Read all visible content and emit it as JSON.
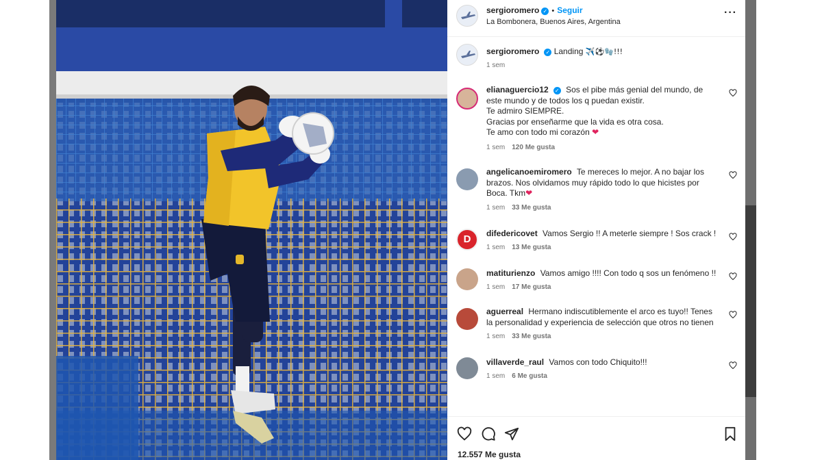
{
  "post": {
    "author": "sergioromero",
    "follow_label": "Seguir",
    "location": "La Bombonera, Buenos Aires, Argentina",
    "caption_text": "Landing",
    "caption_emoji": "✈️⚽🧤!!!",
    "caption_time": "1 sem",
    "likes_total": "12.557 Me gusta"
  },
  "colors": {
    "accent": "#0095f6",
    "secondary_text": "#737373",
    "heart_red": "#e0245e",
    "photo_sky": "#1f3f95",
    "net_yellow": "#e8b43a"
  },
  "comments": [
    {
      "username": "elianaguercio12",
      "verified": true,
      "text": "Sos el pibe más genial del mundo, de este mundo y de todos los q puedan existir.\nTe admiro SIEMPRE.\nGracias por enseñarme que la vida es otra cosa.\nTe amo con todo mi corazón",
      "time": "1 sem",
      "likes": "120 Me gusta"
    },
    {
      "username": "angelicanoemiromero",
      "verified": false,
      "text": "Te mereces lo mejor. A no bajar los brazos. Nos olvidamos muy rápido todo lo que hicistes por Boca. Tkm",
      "time": "1 sem",
      "likes": "33 Me gusta"
    },
    {
      "username": "difedericovet",
      "verified": false,
      "text": "Vamos Sergio !! A meterle siempre ! Sos crack !",
      "time": "1 sem",
      "likes": "13 Me gusta"
    },
    {
      "username": "matiturienzo",
      "verified": false,
      "text": "Vamos amigo !!!! Con todo q sos un fenómeno !!",
      "time": "1 sem",
      "likes": "17 Me gusta"
    },
    {
      "username": "aguerreal",
      "verified": false,
      "text": "Hermano indiscutiblemente el arco es tuyo!! Tenes la personalidad y experiencia de selección que otros no tienen",
      "time": "1 sem",
      "likes": "33 Me gusta"
    },
    {
      "username": "villaverde_raul",
      "verified": false,
      "text": "Vamos con todo Chiquito!!!",
      "time": "1 sem",
      "likes": "6 Me gusta"
    }
  ],
  "icons": {
    "like": "heart-icon",
    "comment": "comment-icon",
    "share": "share-icon",
    "save": "bookmark-icon",
    "more": "more-options-icon"
  }
}
